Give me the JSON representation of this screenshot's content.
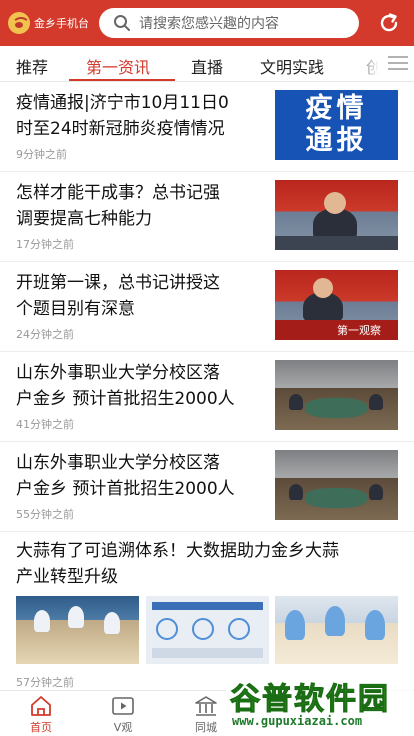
{
  "header": {
    "app_name": "金乡手机台",
    "search_placeholder": "请搜索您感兴趣的内容",
    "accent_color": "#d33a2c"
  },
  "tabs": [
    {
      "label": "推荐",
      "active": false
    },
    {
      "label": "第一资讯",
      "active": true
    },
    {
      "label": "直播",
      "active": false
    },
    {
      "label": "文明实践",
      "active": false
    },
    {
      "label": "创",
      "active": false
    }
  ],
  "news": [
    {
      "title_line1": "疫情通报|济宁市10月11日0",
      "title_line2": "时至24时新冠肺炎疫情情况",
      "time": "9分钟之前",
      "thumb_text1": "疫情",
      "thumb_text2": "通报"
    },
    {
      "title_line1": "怎样才能干成事？总书记强",
      "title_line2": "调要提高七种能力",
      "time": "17分钟之前"
    },
    {
      "title_line1": "开班第一课，总书记讲授这",
      "title_line2": "个题目别有深意",
      "time": "24分钟之前",
      "thumb_caption": "第一观察"
    },
    {
      "title_line1": "山东外事职业大学分校区落",
      "title_line2": "户金乡 预计首批招生2000人",
      "time": "41分钟之前"
    },
    {
      "title_line1": "山东外事职业大学分校区落",
      "title_line2": "户金乡 预计首批招生2000人",
      "time": "55分钟之前"
    },
    {
      "title_line1": "大蒜有了可追溯体系！大数据助力金乡大蒜",
      "title_line2": "产业转型升级",
      "time": "57分钟之前"
    }
  ],
  "bottom_nav": [
    {
      "label": "首页",
      "icon": "home-icon",
      "active": true
    },
    {
      "label": "V观",
      "icon": "video-icon",
      "active": false
    },
    {
      "label": "同城",
      "icon": "building-icon",
      "active": false
    }
  ],
  "watermark": {
    "logo_text": "谷普软件园",
    "url": "www.gupuxiazai.com"
  }
}
